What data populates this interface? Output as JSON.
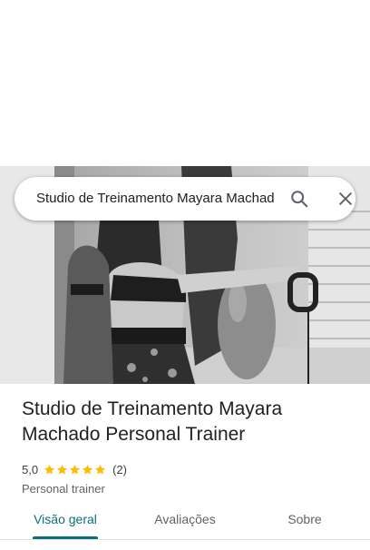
{
  "search": {
    "query": "Studio de Treinamento Mayara Machado Personal Trainer"
  },
  "place": {
    "name": "Studio de Treinamento Mayara Machado Personal Trainer",
    "rating": "5,0",
    "stars": 5,
    "review_count": "(2)",
    "category": "Personal trainer"
  },
  "tabs": [
    {
      "label": "Visão geral",
      "active": true
    },
    {
      "label": "Avaliações",
      "active": false
    },
    {
      "label": "Sobre",
      "active": false
    }
  ],
  "colors": {
    "accent": "#0b6f7a",
    "star": "#fbbc04"
  },
  "icons": {
    "search": "search-icon",
    "close": "close-icon",
    "star": "star-icon"
  }
}
